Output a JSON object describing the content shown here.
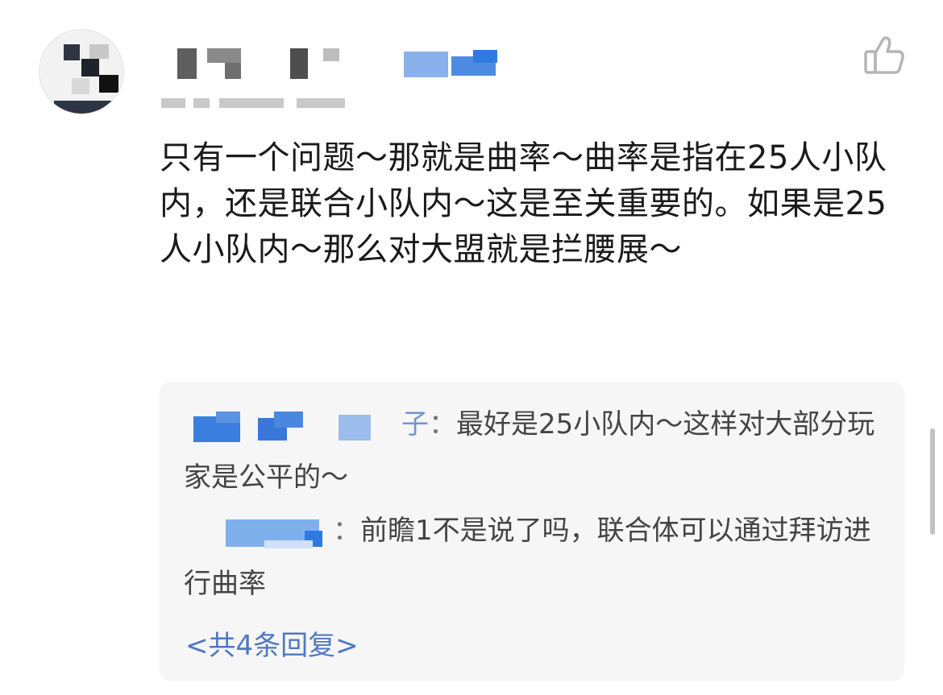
{
  "comment": {
    "text": "只有一个问题～那就是曲率～曲率是指在25人小队内，还是联合小队内～这是至关重要的。如果是25人小队内～那么对大盟就是拦腰展～"
  },
  "replies": [
    {
      "name_tail": "子",
      "text": "最好是25小队内～这样对大部分玩家是公平的～"
    },
    {
      "name_tail": "",
      "text": "前瞻1不是说了吗，联合体可以通过拜访进行曲率"
    }
  ],
  "more_replies_label": "<共4条回复>",
  "colors": {
    "link": "#4e79c2",
    "reply_bg": "#f6f6f7"
  },
  "icons": {
    "like": "thumbs-up-icon"
  }
}
